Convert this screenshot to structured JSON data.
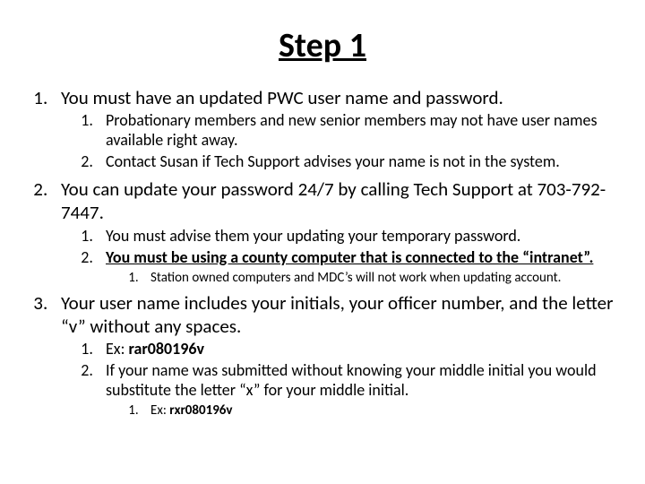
{
  "title": "Step 1",
  "p1": {
    "text": "You must have an updated PWC user name and password.",
    "s1": "Probationary members and new senior members may not have user names available right away.",
    "s2": "Contact Susan if Tech Support advises your name is not in the system."
  },
  "p2": {
    "text": "You can update your password 24/7 by calling Tech Support at 703-792-7447.",
    "s1": "You must advise them your updating your temporary password.",
    "s2": "You must be using a county computer that is connected to the “intranet”.",
    "s2a": "Station owned computers and MDC’s will not work when updating account."
  },
  "p3": {
    "text": "Your user name includes your initials, your officer number, and the letter “v” without any spaces.",
    "s1_prefix": "Ex: ",
    "s1_bold": "rar080196v",
    "s2": "If your name was submitted without knowing your middle initial you would substitute the letter “x” for your middle initial.",
    "s2a_prefix": "Ex: ",
    "s2a_bold": "rxr080196v"
  }
}
